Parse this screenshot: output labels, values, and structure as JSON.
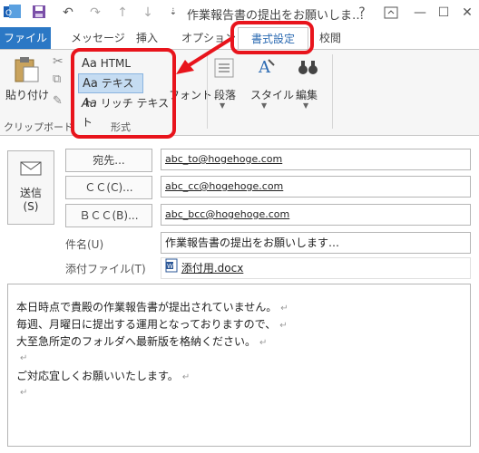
{
  "window": {
    "title": "作業報告書の提出をお願いしま…",
    "help_label": "?",
    "icons": [
      "save-icon",
      "undo-icon",
      "redo-icon",
      "up-arrow-icon",
      "down-arrow-icon",
      "customize-icon"
    ]
  },
  "tabs": {
    "file": "ファイル",
    "message": "メッセージ",
    "insert": "挿入",
    "options": "オプション",
    "format": "書式設定",
    "review": "校閲"
  },
  "ribbon": {
    "paste_label": "貼り付け",
    "clipboard_group": "クリップボード",
    "format_group": "形式",
    "format_options": [
      {
        "prefix": "Aa",
        "label": "HTML"
      },
      {
        "prefix": "Aa",
        "label": "テキスト"
      },
      {
        "prefix": "Aa",
        "label": "リッチ テキスト"
      }
    ],
    "font_label": "フォント",
    "paragraph_label": "段落",
    "style_label": "スタイル",
    "edit_label": "編集"
  },
  "compose": {
    "send_label": "送信",
    "send_sub": "(S)",
    "to_button": "宛先...",
    "cc_button": "ＣＣ(C)...",
    "bcc_button": "ＢＣＣ(B)...",
    "to_value": "abc_to@hogehoge.com",
    "cc_value": "abc_cc@hogehoge.com",
    "bcc_value": "abc_bcc@hogehoge.com",
    "subject_label": "件名(U)",
    "subject_value": "作業報告書の提出をお願いします…",
    "attach_label": "添付ファイル(T)",
    "attach_value": "添付用.docx"
  },
  "body": {
    "lines": [
      "本日時点で貴殿の作業報告書が提出されていません。",
      "毎週、月曜日に提出する運用となっておりますので、",
      "大至急所定のフォルダへ最新版を格納ください。",
      "",
      "ご対応宜しくお願いいたします。",
      ""
    ],
    "para_mark": "↵"
  },
  "colors": {
    "file_tab": "#2b78c5",
    "highlight": "#e8141c",
    "selected_option": "#c5dcf2"
  }
}
